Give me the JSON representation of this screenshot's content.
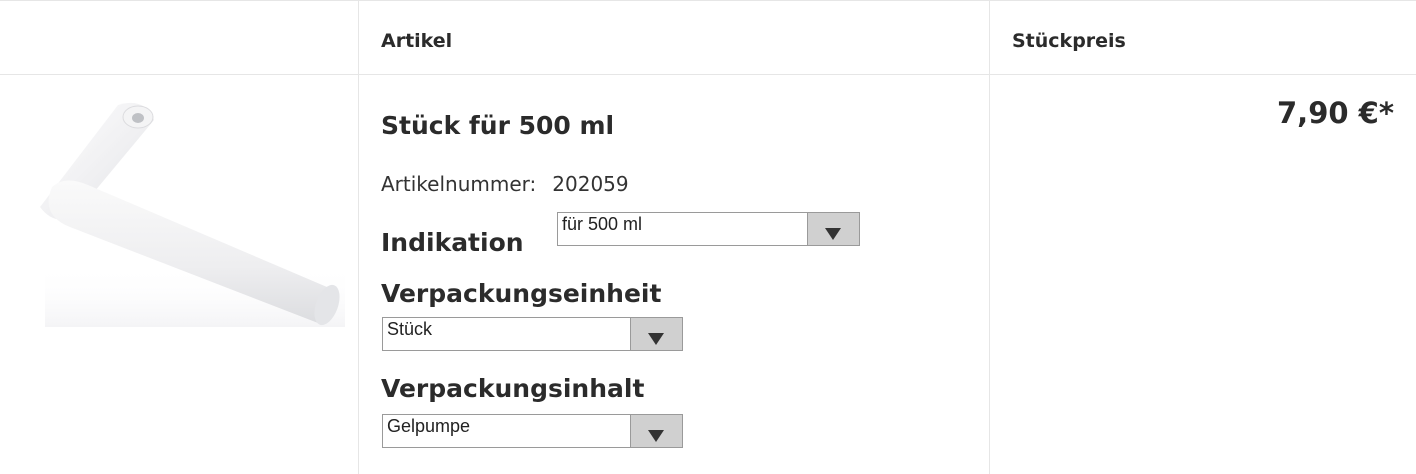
{
  "header": {
    "col_article": "Artikel",
    "col_unit_price": "Stückpreis"
  },
  "product": {
    "image_name": "gel-pump-image",
    "title": "Stück für 500 ml",
    "article_number_label": "Artikelnummer:",
    "article_number": "202059",
    "price": "7,90 €*"
  },
  "options": {
    "indikation": {
      "label": "Indikation",
      "value": "für 500 ml"
    },
    "verpackungseinheit": {
      "label": "Verpackungseinheit",
      "value": "Stück"
    },
    "verpackungsinhalt": {
      "label": "Verpackungsinhalt",
      "value": "Gelpumpe"
    }
  },
  "icons": {
    "dropdown": "chevron-down-icon"
  },
  "colors": {
    "text": "#2b2b2b",
    "border": "#e6e6e6",
    "select_button": "#d0d0d0"
  }
}
